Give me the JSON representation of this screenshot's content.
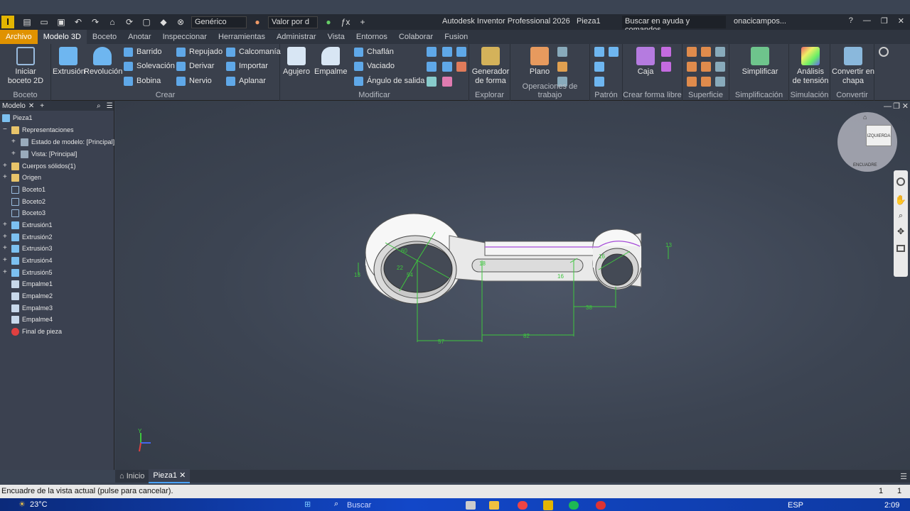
{
  "app_title": "Autodesk Inventor Professional 2026",
  "document_name": "Pieza1",
  "qat": {
    "material": "Genérico",
    "appearance": "Valor por d"
  },
  "help_search": "Buscar en ayuda y comandos...",
  "user": "onacicampos...",
  "tabs": [
    "Archivo",
    "Modelo 3D",
    "Boceto",
    "Anotar",
    "Inspeccionar",
    "Herramientas",
    "Administrar",
    "Vista",
    "Entornos",
    "Colaborar",
    "Fusion"
  ],
  "ribbon": {
    "boceto": {
      "label": "Boceto",
      "start": "Iniciar",
      "start2": "boceto 2D"
    },
    "crear": {
      "label": "Crear",
      "extrusion": "Extrusión",
      "revolucion": "Revolución",
      "barrido": "Barrido",
      "solevacion": "Solevación",
      "bobina": "Bobina",
      "repujado": "Repujado",
      "derivar": "Derivar",
      "nervio": "Nervio",
      "calcomania": "Calcomanía",
      "importar": "Importar",
      "aplanar": "Aplanar"
    },
    "modificar": {
      "label": "Modificar",
      "agujero": "Agujero",
      "empalme": "Empalme",
      "chaflan": "Chaflán",
      "vaciado": "Vaciado",
      "angulo": "Ángulo de salida"
    },
    "explorar": {
      "label": "Explorar",
      "gen1": "Generador",
      "gen2": "de forma"
    },
    "ops": {
      "label": "Operaciones de trabajo",
      "plano": "Plano"
    },
    "patron": {
      "label": "Patrón"
    },
    "libre": {
      "label": "Crear forma libre",
      "caja": "Caja"
    },
    "superficie": {
      "label": "Superficie"
    },
    "simplif": {
      "label": "Simplificación",
      "btn": "Simplificar"
    },
    "simul": {
      "label": "Simulación",
      "b1": "Análisis",
      "b2": "de tensión"
    },
    "convertir": {
      "label": "Convertir",
      "b1": "Convertir en",
      "b2": "chapa"
    }
  },
  "browser": {
    "tab": "Modelo",
    "items": [
      "Pieza1",
      "Representaciones",
      "Estado de modelo: [Principal]",
      "Vista: [Principal]",
      "Cuerpos sólidos(1)",
      "Origen",
      "Boceto1",
      "Boceto2",
      "Boceto3",
      "Extrusión1",
      "Extrusión2",
      "Extrusión3",
      "Extrusión4",
      "Extrusión5",
      "Empalme1",
      "Empalme2",
      "Empalme3",
      "Empalme4",
      "Final de pieza"
    ]
  },
  "dims": [
    "57",
    "82",
    "38",
    "13",
    "13",
    "60",
    "22",
    "54",
    "16",
    "16",
    "18"
  ],
  "viewcube": {
    "face": "IZQUIERDA",
    "bottom": "ENCUADRE"
  },
  "doc_tabs": [
    "Inicio",
    "Pieza1"
  ],
  "status": {
    "text": "Encuadre de la vista actual (pulse para cancelar).",
    "n1": "1",
    "n2": "1"
  },
  "taskbar": {
    "temp": "23°C",
    "search": "Buscar",
    "lang": "ESP",
    "time": "2:09"
  },
  "colors": {
    "accent": "#e09200",
    "dim": "#3ec63e",
    "sketch": "#a64bd9"
  }
}
